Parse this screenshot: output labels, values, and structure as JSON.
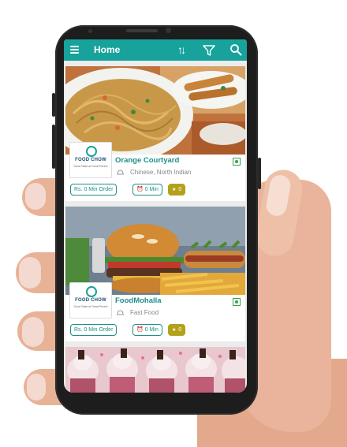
{
  "appbar": {
    "title": "Home",
    "icons": [
      "menu-icon",
      "sort-icon",
      "filter-icon",
      "search-icon"
    ],
    "color": "#17a39b"
  },
  "restaurants": [
    {
      "name": "Orange Courtyard",
      "cuisine": "Chinese, North Indian",
      "logo_text": "FOOD CHOW",
      "logo_tagline": "Good Taste at Great Prices!",
      "min_order": "Rs. 0 Min Order",
      "min_time": "0 Min",
      "rating": "0",
      "image": "noodles-photo",
      "veg_indicator": "veg-icon"
    },
    {
      "name": "FoodMohalla",
      "cuisine": "Fast Food",
      "logo_text": "FOOD CHOW",
      "logo_tagline": "Good Taste at Great Prices!",
      "min_order": "Rs. 0 Min Order",
      "min_time": "0 Min",
      "rating": "0",
      "image": "burger-photo",
      "veg_indicator": "veg-icon"
    },
    {
      "image": "cupcakes-photo"
    }
  ],
  "colors": {
    "accent": "#17a39b",
    "name_text": "#1d8f88",
    "rating_chip": "#b3a11b",
    "veg": "#37a34a"
  }
}
